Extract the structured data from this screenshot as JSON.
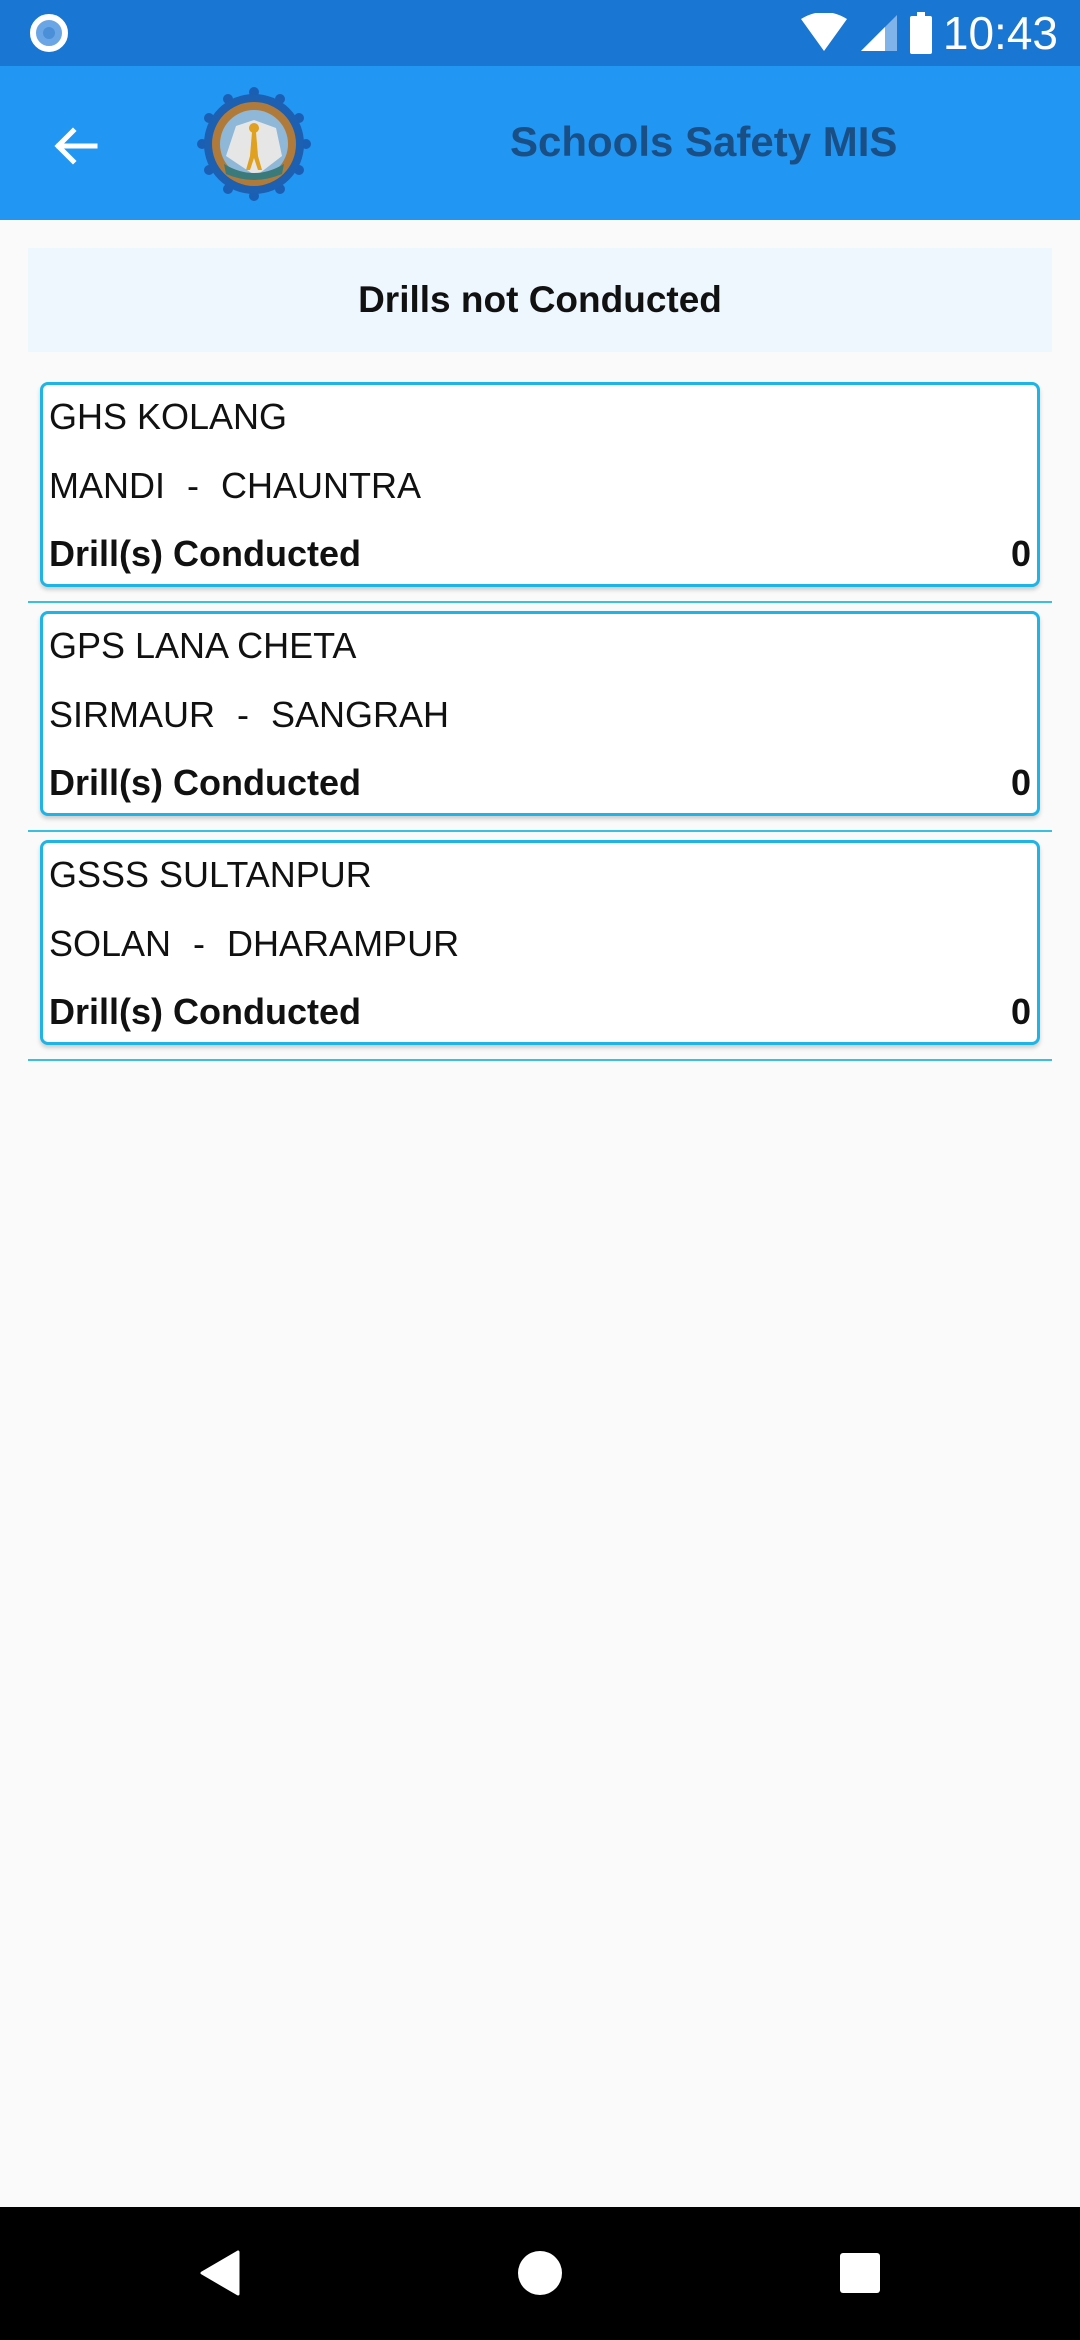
{
  "status_bar": {
    "time": "10:43",
    "icons": [
      "notification-dot-icon",
      "wifi-icon",
      "signal-icon",
      "battery-icon"
    ]
  },
  "app_bar": {
    "back_icon": "arrow-back-icon",
    "logo": "HPSDMA emblem",
    "title": "Schools Safety MIS"
  },
  "section": {
    "title": "Drills not Conducted"
  },
  "schools": [
    {
      "name": "GHS KOLANG",
      "district": "MANDI",
      "separator": "-",
      "block": "CHAUNTRA",
      "drills_label": "Drill(s) Conducted",
      "drills_count": "0"
    },
    {
      "name": "GPS LANA CHETA",
      "district": "SIRMAUR",
      "separator": "-",
      "block": "SANGRAH",
      "drills_label": "Drill(s) Conducted",
      "drills_count": "0"
    },
    {
      "name": "GSSS SULTANPUR",
      "district": "SOLAN",
      "separator": "-",
      "block": "DHARAMPUR",
      "drills_label": "Drill(s) Conducted",
      "drills_count": "0"
    }
  ],
  "nav_bar": {
    "buttons": [
      "back",
      "home",
      "recents"
    ]
  },
  "colors": {
    "status_bar": "#1976d2",
    "app_bar": "#2196f3",
    "title_text": "#1a4f86",
    "card_border": "#1eb4e6",
    "header_band": "#eef6fe"
  }
}
